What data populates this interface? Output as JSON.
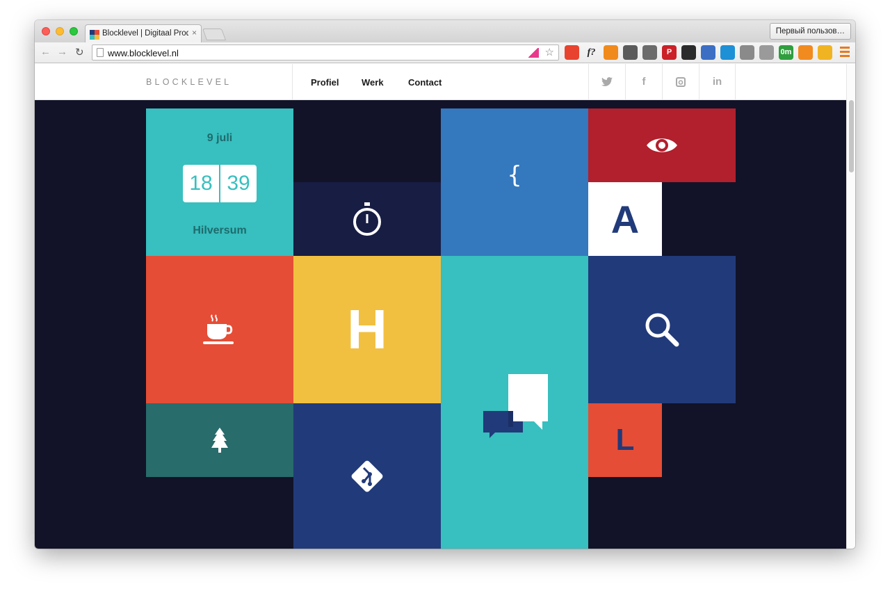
{
  "browser": {
    "tab_title": "Blocklevel | Digitaal Produc",
    "tab_close": "×",
    "profile_button": "Первый пользов…",
    "url": "www.blocklevel.nl",
    "back_glyph": "←",
    "forward_glyph": "→",
    "reload_glyph": "↻",
    "star_glyph": "☆",
    "extensions": [
      {
        "name": "shield-icon",
        "glyph": "",
        "color": "#e8432e"
      },
      {
        "name": "font-icon",
        "glyph": "f?",
        "color": "#ffffff"
      },
      {
        "name": "fire-icon",
        "glyph": "",
        "color": "#f08a1c"
      },
      {
        "name": "evernote-icon",
        "glyph": "",
        "color": "#5a5a5a"
      },
      {
        "name": "pocket-icon",
        "glyph": "",
        "color": "#6b6b6b"
      },
      {
        "name": "pinterest-icon",
        "glyph": "P",
        "color": "#cb2027"
      },
      {
        "name": "lens-icon",
        "glyph": "",
        "color": "#2b2b2b"
      },
      {
        "name": "eyedropper-icon",
        "glyph": "",
        "color": "#3c6fc4"
      },
      {
        "name": "diamond-icon",
        "glyph": "",
        "color": "#1e90d6"
      },
      {
        "name": "ring-icon",
        "glyph": "",
        "color": "#8a8a8a"
      },
      {
        "name": "reader-icon",
        "glyph": "",
        "color": "#9a9a9a"
      },
      {
        "name": "badge-icon",
        "glyph": "0m",
        "color": "#2f9e3e"
      },
      {
        "name": "chart-icon",
        "glyph": "",
        "color": "#f28b1f"
      },
      {
        "name": "paw-icon",
        "glyph": "",
        "color": "#f0b423"
      }
    ]
  },
  "site": {
    "logo": "BLOCKLEVEL",
    "nav": [
      "Profiel",
      "Werk",
      "Contact"
    ],
    "social": [
      {
        "name": "twitter-icon",
        "glyph": "🐦"
      },
      {
        "name": "facebook-icon",
        "glyph": "f"
      },
      {
        "name": "instagram-icon",
        "glyph": "◘"
      },
      {
        "name": "linkedin-icon",
        "glyph": "in"
      }
    ]
  },
  "clock": {
    "date": "9 juli",
    "hours": "18",
    "minutes": "39",
    "city": "Hilversum"
  },
  "tiles": {
    "letter_h": "H",
    "letter_a": "A",
    "letter_l": "L",
    "brace": "{"
  },
  "colors": {
    "page_bg": "#121328",
    "teal": "#38bfbf",
    "dark_navy": "#181d44",
    "blue": "#3478be",
    "red": "#b21f2d",
    "orange": "#e54d36",
    "yellow": "#f2c040",
    "navy": "#213a7a",
    "green": "#286c6c",
    "white": "#ffffff"
  }
}
